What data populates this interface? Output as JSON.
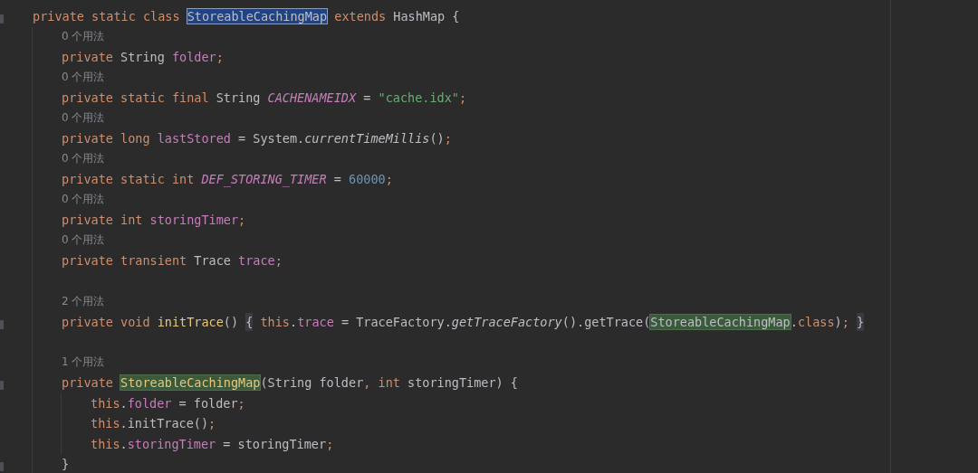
{
  "editor": {
    "lines": [
      {
        "kind": "code",
        "fold_marker": true,
        "tokens": [
          {
            "kind": "kw",
            "s": "private static class "
          },
          {
            "kind": "plain",
            "s": "StoreableCachingMap",
            "selected": true
          },
          {
            "kind": "kw",
            "s": " extends "
          },
          {
            "kind": "plain",
            "s": "HashMap {"
          }
        ],
        "children": [
          {
            "kind": "hint",
            "text": "0 个用法"
          },
          {
            "kind": "code",
            "fold_marker": false,
            "tokens": [
              {
                "kind": "kw",
                "s": "private "
              },
              {
                "kind": "plain",
                "s": "String "
              },
              {
                "kind": "field",
                "s": "folder"
              },
              {
                "kind": "kw",
                "s": ";"
              }
            ]
          },
          {
            "kind": "hint",
            "text": "0 个用法"
          },
          {
            "kind": "code",
            "fold_marker": false,
            "tokens": [
              {
                "kind": "kw",
                "s": "private static final "
              },
              {
                "kind": "plain",
                "s": "String "
              },
              {
                "kind": "const",
                "s": "CACHENAMEIDX"
              },
              {
                "kind": "plain",
                "s": " = "
              },
              {
                "kind": "str",
                "s": "\"cache.idx\""
              },
              {
                "kind": "kw",
                "s": ";"
              }
            ]
          },
          {
            "kind": "hint",
            "text": "0 个用法"
          },
          {
            "kind": "code",
            "fold_marker": false,
            "tokens": [
              {
                "kind": "kw",
                "s": "private long "
              },
              {
                "kind": "field",
                "s": "lastStored"
              },
              {
                "kind": "plain",
                "s": " = System."
              },
              {
                "kind": "static_call",
                "s": "currentTimeMillis"
              },
              {
                "kind": "plain",
                "s": "()"
              },
              {
                "kind": "kw",
                "s": ";"
              }
            ]
          },
          {
            "kind": "hint",
            "text": "0 个用法"
          },
          {
            "kind": "code",
            "fold_marker": false,
            "tokens": [
              {
                "kind": "kw",
                "s": "private static int "
              },
              {
                "kind": "const",
                "s": "DEF_STORING_TIMER"
              },
              {
                "kind": "plain",
                "s": " = "
              },
              {
                "kind": "num",
                "s": "60000"
              },
              {
                "kind": "kw",
                "s": ";"
              }
            ]
          },
          {
            "kind": "hint",
            "text": "0 个用法"
          },
          {
            "kind": "code",
            "fold_marker": false,
            "tokens": [
              {
                "kind": "kw",
                "s": "private int "
              },
              {
                "kind": "field",
                "s": "storingTimer"
              },
              {
                "kind": "kw",
                "s": ";"
              }
            ]
          },
          {
            "kind": "hint",
            "text": "0 个用法"
          },
          {
            "kind": "code",
            "fold_marker": false,
            "tokens": [
              {
                "kind": "kw",
                "s": "private transient "
              },
              {
                "kind": "plain",
                "s": "Trace "
              },
              {
                "kind": "field",
                "s": "trace"
              },
              {
                "kind": "kw",
                "s": ";"
              }
            ]
          },
          {
            "kind": "blank"
          },
          {
            "kind": "hint",
            "text": "2 个用法"
          },
          {
            "kind": "code",
            "fold_marker": true,
            "tokens": [
              {
                "kind": "kw",
                "s": "private void "
              },
              {
                "kind": "decl",
                "s": "initTrace"
              },
              {
                "kind": "plain",
                "s": "() "
              },
              {
                "kind": "plain",
                "s": "{",
                "brace_match": true
              },
              {
                "kind": "kw",
                "s": " this"
              },
              {
                "kind": "plain",
                "s": "."
              },
              {
                "kind": "field",
                "s": "trace"
              },
              {
                "kind": "plain",
                "s": " = TraceFactory."
              },
              {
                "kind": "static_call",
                "s": "getTraceFactory"
              },
              {
                "kind": "plain",
                "s": "().getTrace("
              },
              {
                "kind": "plain",
                "s": "StoreableCachingMap",
                "usage": true
              },
              {
                "kind": "plain",
                "s": "."
              },
              {
                "kind": "kw",
                "s": "class"
              },
              {
                "kind": "plain",
                "s": ")"
              },
              {
                "kind": "kw",
                "s": "; "
              },
              {
                "kind": "plain",
                "s": "}",
                "brace_match": true
              }
            ]
          },
          {
            "kind": "blank"
          },
          {
            "kind": "hint",
            "text": "1 个用法"
          },
          {
            "kind": "code",
            "fold_marker": true,
            "tokens": [
              {
                "kind": "kw",
                "s": "private "
              },
              {
                "kind": "decl",
                "s": "StoreableCachingMap",
                "usage": true
              },
              {
                "kind": "plain",
                "s": "(String folder"
              },
              {
                "kind": "kw",
                "s": ", int "
              },
              {
                "kind": "plain",
                "s": "storingTimer) {"
              }
            ],
            "children": [
              {
                "kind": "code",
                "fold_marker": false,
                "tokens": [
                  {
                    "kind": "kw",
                    "s": "this"
                  },
                  {
                    "kind": "plain",
                    "s": "."
                  },
                  {
                    "kind": "field",
                    "s": "folder"
                  },
                  {
                    "kind": "plain",
                    "s": " = folder"
                  },
                  {
                    "kind": "kw",
                    "s": ";"
                  }
                ]
              },
              {
                "kind": "code",
                "fold_marker": false,
                "tokens": [
                  {
                    "kind": "kw",
                    "s": "this"
                  },
                  {
                    "kind": "plain",
                    "s": ".initTrace()"
                  },
                  {
                    "kind": "kw",
                    "s": ";"
                  }
                ]
              },
              {
                "kind": "code",
                "fold_marker": false,
                "tokens": [
                  {
                    "kind": "kw",
                    "s": "this"
                  },
                  {
                    "kind": "plain",
                    "s": "."
                  },
                  {
                    "kind": "field",
                    "s": "storingTimer"
                  },
                  {
                    "kind": "plain",
                    "s": " = storingTimer"
                  },
                  {
                    "kind": "kw",
                    "s": ";"
                  }
                ]
              }
            ]
          },
          {
            "kind": "code",
            "fold_marker": true,
            "tokens": [
              {
                "kind": "plain",
                "s": "}"
              }
            ]
          }
        ]
      }
    ]
  }
}
